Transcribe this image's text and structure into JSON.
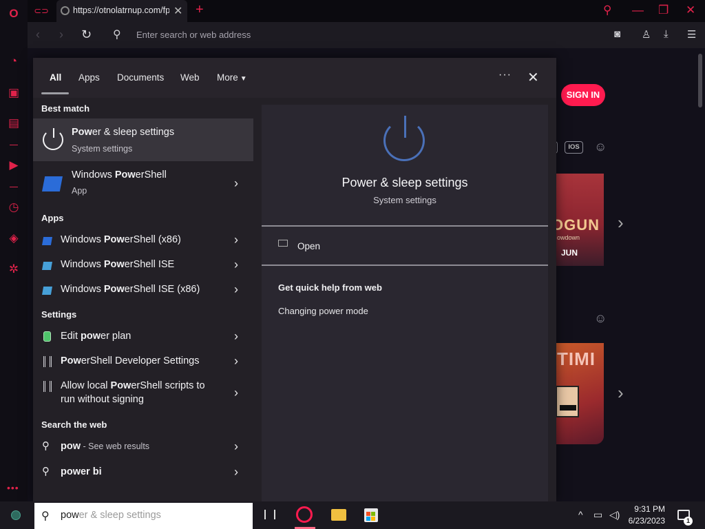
{
  "browser": {
    "tab_title": "https://otnolatrnup.com/fp",
    "address_placeholder": "Enter search or web address",
    "sign_in_label": "SIGN IN",
    "ios_badge": "IOS",
    "card1_title": "OGUN",
    "card1_sub": "owdown",
    "card1_date": "JUN",
    "card2_title": "TIMI"
  },
  "search_panel": {
    "tabs": [
      "All",
      "Apps",
      "Documents",
      "Web",
      "More"
    ],
    "sections": {
      "best_match": "Best match",
      "apps": "Apps",
      "settings": "Settings",
      "search_web": "Search the web"
    },
    "best_match": {
      "title_bold": "Pow",
      "title_rest": "er & sleep settings",
      "sub": "System settings"
    },
    "best_match_2": {
      "title_pre": "Windows ",
      "title_bold": "Pow",
      "title_rest": "erShell",
      "sub": "App"
    },
    "apps": [
      {
        "pre": "Windows ",
        "bold": "Pow",
        "rest": "erShell (x86)"
      },
      {
        "pre": "Windows ",
        "bold": "Pow",
        "rest": "erShell ISE"
      },
      {
        "pre": "Windows ",
        "bold": "Pow",
        "rest": "erShell ISE (x86)"
      }
    ],
    "settings": [
      {
        "pre": "Edit ",
        "bold": "pow",
        "rest": "er plan"
      },
      {
        "pre": "",
        "bold": "Pow",
        "rest": "erShell Developer Settings"
      },
      {
        "pre": "Allow local ",
        "bold": "Pow",
        "rest": "erShell scripts to",
        "line2": "run without signing"
      }
    ],
    "web": [
      {
        "bold": "pow",
        "suffix": " - See web results"
      },
      {
        "bold": "power bi",
        "suffix": ""
      }
    ],
    "preview": {
      "title": "Power & sleep settings",
      "sub": "System settings",
      "open": "Open",
      "help_heading": "Get quick help from web",
      "help_link": "Changing power mode"
    }
  },
  "taskbar": {
    "search_typed": "pow",
    "search_ghost": "er & sleep settings",
    "time": "9:31 PM",
    "date": "6/23/2023",
    "notification_count": "1"
  },
  "colors": {
    "accent": "#ff1b4f",
    "panel": "#232026",
    "highlight": "#38353c",
    "preview_icon": "#4a70b8"
  }
}
